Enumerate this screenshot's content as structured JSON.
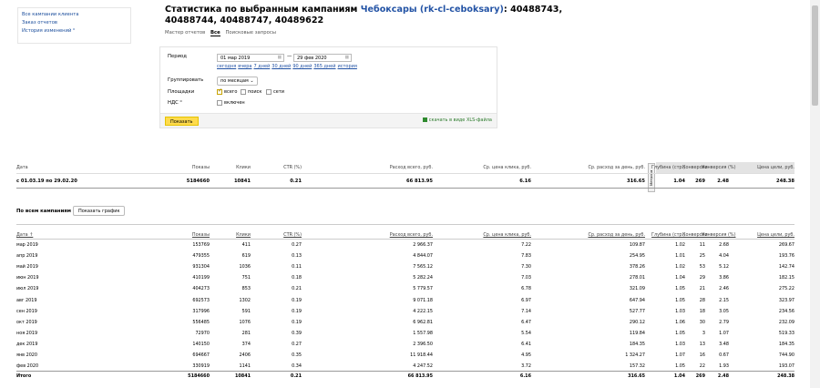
{
  "sidebar": {
    "links": [
      "Все кампании клиента",
      "Заказ отчетов",
      "История изменений ⁰"
    ]
  },
  "title": {
    "prefix": "Статистика по выбранным кампаниям ",
    "link": "Чебоксары (rk-cl-ceboksary)",
    "suffix": ": 40488743, 40488744, 40488747, 40489622"
  },
  "tabs": [
    "Мастер отчетов",
    "Все",
    "Поисковые запросы"
  ],
  "form": {
    "period_label": "Период",
    "date_from": "01 мар 2019",
    "date_to": "29 фев 2020",
    "quick": [
      "сегодня",
      "вчера",
      "7 дней",
      "30 дней",
      "90 дней",
      "365 дней",
      "история"
    ],
    "group_label": "Группировать",
    "group_value": "по месяцам ⌄",
    "places_label": "Площадки",
    "places": [
      "всего",
      "поиск",
      "сети"
    ],
    "vat_label": "НДС ⁰",
    "vat_value": "включен",
    "show_button": "Показать",
    "xls_link": "скачать в виде XLS-файла"
  },
  "summary": {
    "headers": [
      "Дата",
      "Показы",
      "Клики",
      "CTR (%)",
      "Расход всего, руб.",
      "Ср. цена клика, руб.",
      "Ср. расход за день, руб.",
      "Глубина (стр.)",
      "Конверсии",
      "Конверсия (%)",
      "Цена цели, руб."
    ],
    "row": [
      "с 01.03.19 по 29.02.20",
      "5184660",
      "10841",
      "0.21",
      "66 813.95",
      "6.16",
      "316.65",
      "1.04",
      "269",
      "2.48",
      "248.38"
    ],
    "vtag": "Метрика"
  },
  "all_campaigns": "По всем кампаниям",
  "graph_button": "Показать график",
  "table": {
    "headers": [
      "Дата ↑",
      "Показы",
      "Клики",
      "CTR (%)",
      "Расход всего, руб.",
      "Ср. цена клика, руб.",
      "Ср. расход за день, руб.",
      "Глубина (стр.)",
      "Конверсии",
      "Конверсия (%)",
      "Цена цели, руб."
    ],
    "rows": [
      [
        "мар 2019",
        "153769",
        "411",
        "0.27",
        "2 966.37",
        "7.22",
        "109.87",
        "1.02",
        "11",
        "2.68",
        "269.67"
      ],
      [
        "апр 2019",
        "479355",
        "619",
        "0.13",
        "4 844.07",
        "7.83",
        "254.95",
        "1.01",
        "25",
        "4.04",
        "193.76"
      ],
      [
        "май 2019",
        "931304",
        "1036",
        "0.11",
        "7 565.12",
        "7.30",
        "378.26",
        "1.02",
        "53",
        "5.12",
        "142.74"
      ],
      [
        "июн 2019",
        "410199",
        "751",
        "0.18",
        "5 282.24",
        "7.03",
        "278.01",
        "1.04",
        "29",
        "3.86",
        "182.15"
      ],
      [
        "июл 2019",
        "404273",
        "853",
        "0.21",
        "5 779.57",
        "6.78",
        "321.09",
        "1.05",
        "21",
        "2.46",
        "275.22"
      ],
      [
        "авг 2019",
        "692573",
        "1302",
        "0.19",
        "9 071.18",
        "6.97",
        "647.94",
        "1.05",
        "28",
        "2.15",
        "323.97"
      ],
      [
        "сен 2019",
        "317996",
        "591",
        "0.19",
        "4 222.15",
        "7.14",
        "527.77",
        "1.03",
        "18",
        "3.05",
        "234.56"
      ],
      [
        "окт 2019",
        "556485",
        "1076",
        "0.19",
        "6 962.81",
        "6.47",
        "290.12",
        "1.06",
        "30",
        "2.79",
        "232.09"
      ],
      [
        "ноя 2019",
        "72970",
        "281",
        "0.39",
        "1 557.98",
        "5.54",
        "119.84",
        "1.05",
        "3",
        "1.07",
        "519.33"
      ],
      [
        "дек 2019",
        "140150",
        "374",
        "0.27",
        "2 396.50",
        "6.41",
        "184.35",
        "1.03",
        "13",
        "3.48",
        "184.35"
      ],
      [
        "янв 2020",
        "694667",
        "2406",
        "0.35",
        "11 918.44",
        "4.95",
        "1 324.27",
        "1.07",
        "16",
        "0.67",
        "744.90"
      ],
      [
        "фев 2020",
        "330919",
        "1141",
        "0.34",
        "4 247.52",
        "3.72",
        "157.32",
        "1.05",
        "22",
        "1.93",
        "193.07"
      ]
    ],
    "total": [
      "Итого",
      "5184660",
      "10841",
      "0.21",
      "66 813.95",
      "6.16",
      "316.65",
      "1.04",
      "269",
      "2.48",
      "248.38"
    ]
  }
}
